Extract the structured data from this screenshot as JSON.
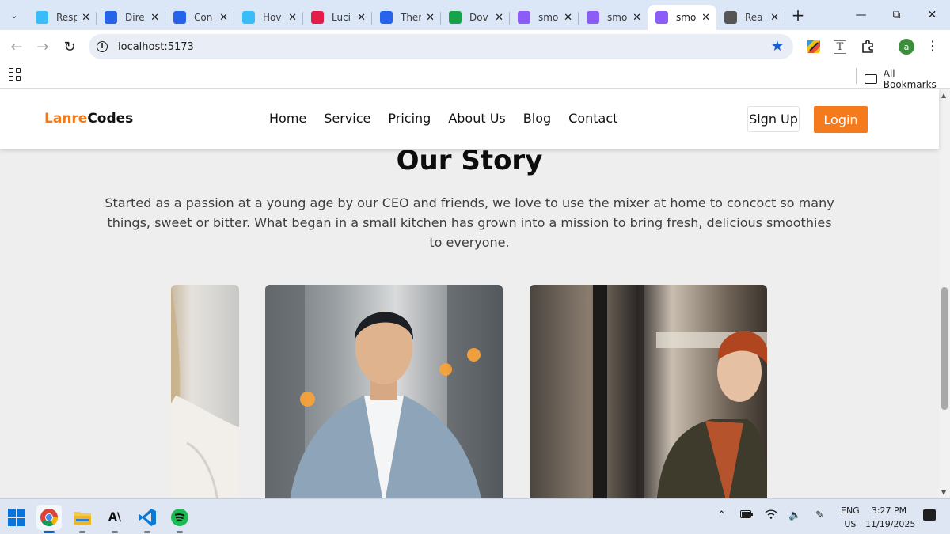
{
  "browser": {
    "tabs": [
      {
        "title": "Resp",
        "favicon": "tailwind-icon",
        "color": "#38bdf8",
        "active": false
      },
      {
        "title": "Dire",
        "favicon": "codesandbox-icon",
        "color": "#2563eb",
        "active": false
      },
      {
        "title": "Con",
        "favicon": "codesandbox-icon",
        "color": "#2563eb",
        "active": false
      },
      {
        "title": "Hov",
        "favicon": "tailwind-icon",
        "color": "#38bdf8",
        "active": false
      },
      {
        "title": "Luci",
        "favicon": "lucide-icon",
        "color": "#e11d48",
        "active": false
      },
      {
        "title": "Ther",
        "favicon": "codesandbox-icon",
        "color": "#2563eb",
        "active": false
      },
      {
        "title": "Dov",
        "favicon": "pexels-icon",
        "color": "#16a34a",
        "active": false
      },
      {
        "title": "smo",
        "favicon": "vite-icon",
        "color": "#8b5cf6",
        "active": false
      },
      {
        "title": "smo",
        "favicon": "vite-icon",
        "color": "#8b5cf6",
        "active": false
      },
      {
        "title": "smo",
        "favicon": "vite-icon",
        "color": "#8b5cf6",
        "active": true
      },
      {
        "title": "Rea",
        "favicon": "react-icon",
        "color": "#555555",
        "active": false
      }
    ],
    "url": "localhost:5173",
    "bookmarks_all": "All Bookmarks",
    "profile_initial": "a"
  },
  "site": {
    "logo_accent": "Lanre",
    "logo_rest": "Codes",
    "nav": [
      "Home",
      "Service",
      "Pricing",
      "About Us",
      "Blog",
      "Contact"
    ],
    "signup_label": "Sign Up",
    "login_label": "Login",
    "accent_color": "#f47a1b"
  },
  "story": {
    "title": "Our Story",
    "text": "Started as a passion at a young age by our CEO and friends, we love to use the mixer at home to concoct so many things, sweet or bitter. What began in a small kitchen has grown into a mission to bring fresh, delicious smoothies to everyone."
  },
  "taskbar": {
    "lang_line1": "ENG",
    "lang_line2": "US",
    "time": "3:27 PM",
    "date": "11/19/2025"
  }
}
